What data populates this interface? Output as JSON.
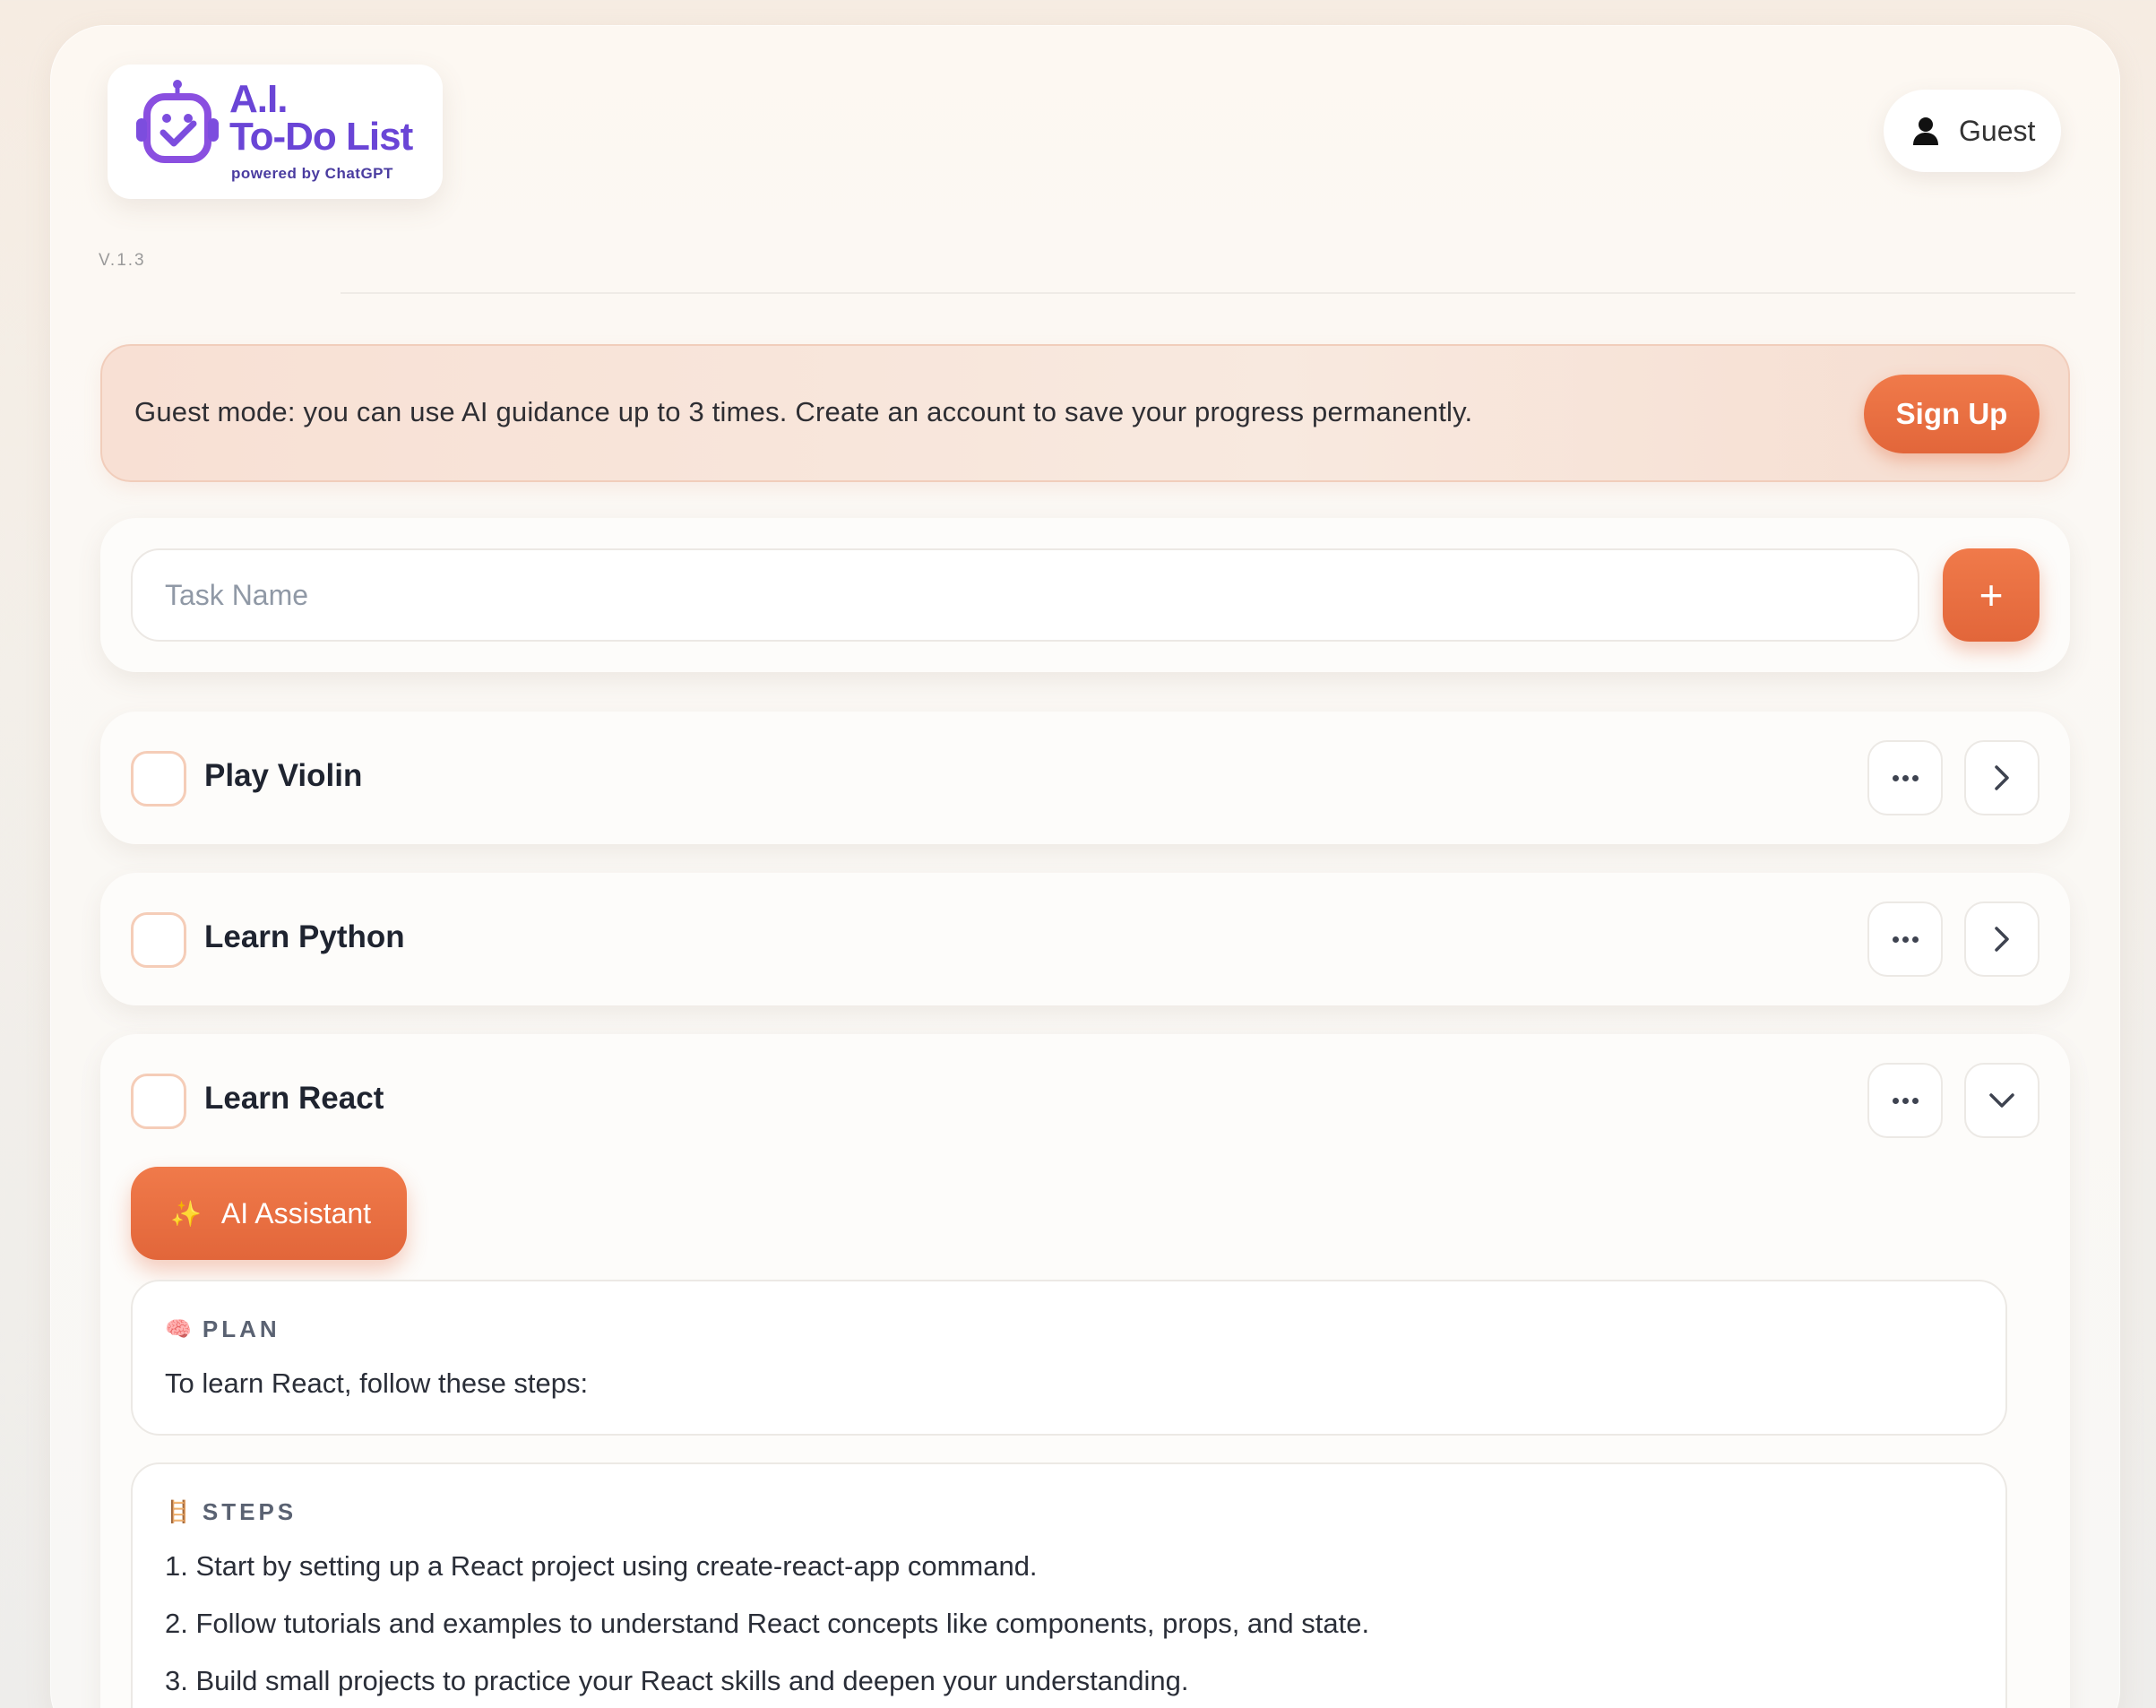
{
  "app": {
    "logo_title_line1": "A.I.",
    "logo_title_line2": "To-Do List",
    "logo_subtitle": "powered by ChatGPT",
    "version": "V.1.3"
  },
  "user": {
    "label": "Guest",
    "icon": "user-icon"
  },
  "banner": {
    "text": "Guest mode: you can use AI guidance up to 3 times. Create an account to save your progress permanently.",
    "signup_label": "Sign Up"
  },
  "add_task": {
    "placeholder": "Task Name",
    "value": "",
    "add_label": "+"
  },
  "tasks": [
    {
      "name": "Play Violin",
      "expanded": false
    },
    {
      "name": "Learn Python",
      "expanded": false
    },
    {
      "name": "Learn React",
      "expanded": true,
      "ai_button_label": "AI Assistant",
      "plan": {
        "icon": "🧠",
        "heading": "PLAN",
        "text": "To learn React, follow these steps:"
      },
      "steps": {
        "icon": "🪜",
        "heading": "STEPS",
        "items": [
          "1. Start by setting up a React project using create-react-app command.",
          "2. Follow tutorials and examples to understand React concepts like components, props, and state.",
          "3. Build small projects to practice your React skills and deepen your understanding."
        ]
      }
    }
  ],
  "colors": {
    "accent": "#e86d40",
    "brand_purple": "#6a45d6",
    "banner_bg": "#f8e3d8",
    "checkbox_border": "#f5cdb8"
  }
}
